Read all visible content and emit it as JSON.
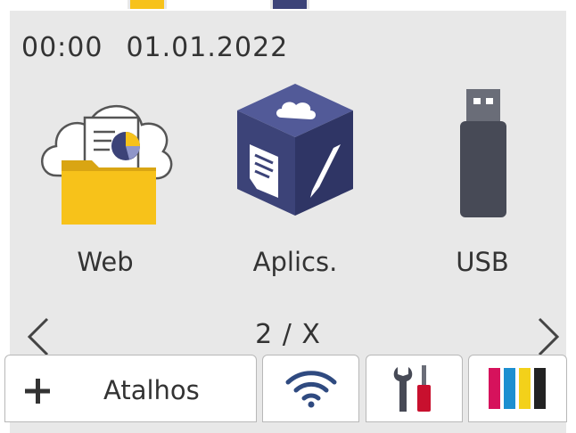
{
  "status": {
    "time": "00:00",
    "date": "01.01.2022"
  },
  "apps": [
    {
      "label": "Web",
      "icon": "web-folder-cloud-icon"
    },
    {
      "label": "Aplics.",
      "icon": "apps-cube-icon"
    },
    {
      "label": "USB",
      "icon": "usb-drive-icon"
    }
  ],
  "pager": {
    "indicator": "2 / X",
    "prev_icon": "chevron-left-icon",
    "next_icon": "chevron-right-icon"
  },
  "bottom_bar": {
    "shortcuts_label": "Atalhos",
    "shortcuts_icon": "plus-icon",
    "wifi_icon": "wifi-icon",
    "settings_icon": "tools-icon",
    "toner_icon": "toner-icon"
  },
  "colors": {
    "panel_bg": "#e8e8e8",
    "folder_yellow": "#f7c21a",
    "cube_blue": "#3c4378",
    "usb_dark": "#474a56",
    "wifi_blue": "#2f4a80",
    "toner_magenta": "#d6125c",
    "toner_cyan": "#1d8fd0",
    "toner_yellow": "#f3d11a",
    "toner_black": "#222222"
  }
}
